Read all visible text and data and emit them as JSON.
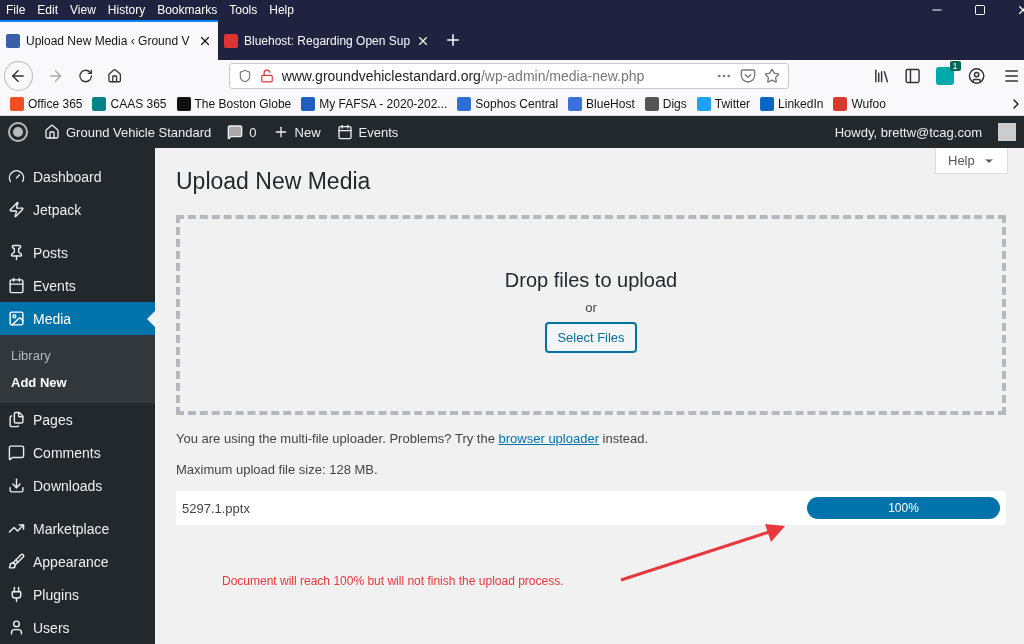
{
  "menu_bar": [
    "File",
    "Edit",
    "View",
    "History",
    "Bookmarks",
    "Tools",
    "Help"
  ],
  "tabs": [
    {
      "label": "Upload New Media ‹ Ground V",
      "selected": true
    },
    {
      "label": "Bluehost: Regarding Open Sup",
      "selected": false
    }
  ],
  "address_bar": {
    "domain": "www.groundvehiclestandard.org",
    "path": "/wp-admin/media-new.php"
  },
  "extension_badge": "1",
  "bookmarks": [
    {
      "label": "Office 365",
      "color": "#f25022"
    },
    {
      "label": "CAAS 365",
      "color": "#038387"
    },
    {
      "label": "The Boston Globe",
      "color": "#111111"
    },
    {
      "label": "My FAFSA - 2020-202...",
      "color": "#1f5fbf"
    },
    {
      "label": "Sophos Central",
      "color": "#2f6fd6"
    },
    {
      "label": "BlueHost",
      "color": "#3b6fd9"
    },
    {
      "label": "Digs",
      "color": "#555555"
    },
    {
      "label": "Twitter",
      "color": "#1da1f2"
    },
    {
      "label": "LinkedIn",
      "color": "#0a66c2"
    },
    {
      "label": "Wufoo",
      "color": "#d83a2e"
    }
  ],
  "admin_bar": {
    "site": "Ground Vehicle Standard",
    "comments": "0",
    "new": "New",
    "events": "Events",
    "greeting": "Howdy, brettw@tcag.com"
  },
  "sidebar": {
    "groups": [
      [
        {
          "label": "Dashboard",
          "selected": false
        },
        {
          "label": "Jetpack",
          "selected": false
        }
      ],
      [
        {
          "label": "Posts",
          "selected": false
        },
        {
          "label": "Events",
          "selected": false
        },
        {
          "label": "Media",
          "selected": true,
          "children": [
            {
              "label": "Library",
              "selected": false
            },
            {
              "label": "Add New",
              "selected": true
            }
          ]
        },
        {
          "label": "Pages",
          "selected": false
        },
        {
          "label": "Comments",
          "selected": false
        },
        {
          "label": "Downloads",
          "selected": false
        }
      ],
      [
        {
          "label": "Marketplace",
          "selected": false
        },
        {
          "label": "Appearance",
          "selected": false
        },
        {
          "label": "Plugins",
          "selected": false
        },
        {
          "label": "Users",
          "selected": false
        }
      ]
    ]
  },
  "help_button": "Help",
  "title": "Upload New Media",
  "dropzone": {
    "heading": "Drop files to upload",
    "or": "or",
    "button": "Select Files"
  },
  "notice": {
    "before": "You are using the multi-file uploader. Problems? Try the ",
    "link": "browser uploader",
    "after": " instead."
  },
  "max_size": "Maximum upload file size: 128 MB.",
  "upload": {
    "file": "5297.1.pptx",
    "level": 1,
    "reading": "100%"
  },
  "annotation": "Document will reach 100% but will not finish the upload process."
}
